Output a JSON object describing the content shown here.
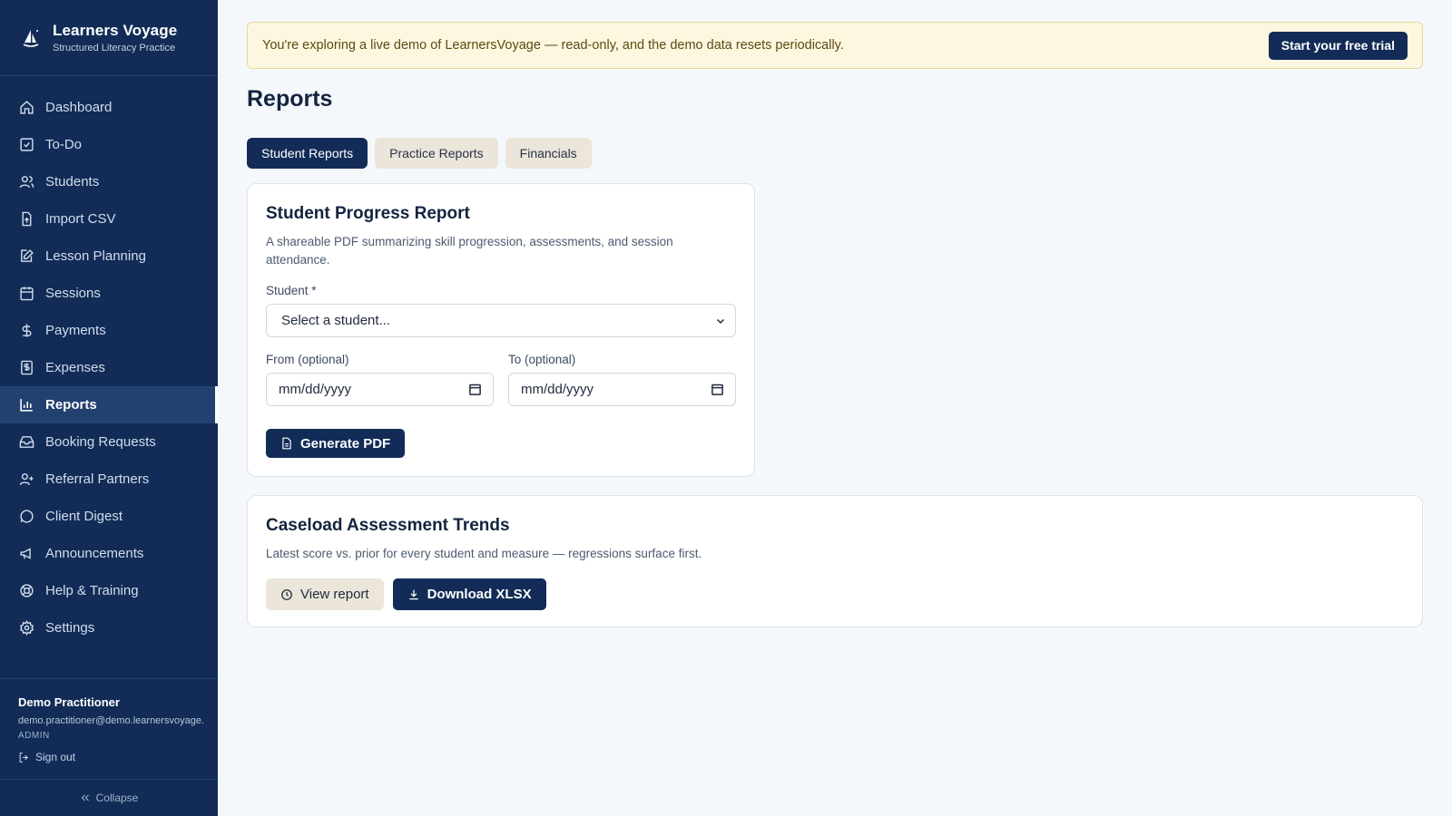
{
  "brand": {
    "title": "Learners Voyage",
    "subtitle": "Structured Literacy Practice"
  },
  "sidebar": {
    "items": [
      {
        "label": "Dashboard",
        "icon": "home-icon"
      },
      {
        "label": "To-Do",
        "icon": "checkbox-icon"
      },
      {
        "label": "Students",
        "icon": "users-icon"
      },
      {
        "label": "Import CSV",
        "icon": "file-upload-icon"
      },
      {
        "label": "Lesson Planning",
        "icon": "edit-icon"
      },
      {
        "label": "Sessions",
        "icon": "calendar-icon"
      },
      {
        "label": "Payments",
        "icon": "dollar-icon"
      },
      {
        "label": "Expenses",
        "icon": "receipt-icon"
      },
      {
        "label": "Reports",
        "icon": "bar-chart-icon",
        "active": true
      },
      {
        "label": "Booking Requests",
        "icon": "inbox-icon"
      },
      {
        "label": "Referral Partners",
        "icon": "user-plus-icon"
      },
      {
        "label": "Client Digest",
        "icon": "message-icon"
      },
      {
        "label": "Announcements",
        "icon": "megaphone-icon"
      },
      {
        "label": "Help & Training",
        "icon": "lifebuoy-icon"
      },
      {
        "label": "Settings",
        "icon": "gear-icon"
      }
    ]
  },
  "user": {
    "name": "Demo Practitioner",
    "email": "demo.practitioner@demo.learnersvoyage.",
    "role": "ADMIN",
    "signout": "Sign out"
  },
  "collapse_label": "Collapse",
  "banner": {
    "text": "You're exploring a live demo of LearnersVoyage — read-only, and the demo data resets periodically.",
    "cta": "Start your free trial"
  },
  "page_title": "Reports",
  "tabs": [
    {
      "label": "Student Reports",
      "active": true
    },
    {
      "label": "Practice Reports",
      "active": false
    },
    {
      "label": "Financials",
      "active": false
    }
  ],
  "progress_card": {
    "title": "Student Progress Report",
    "description": "A shareable PDF summarizing skill progression, assessments, and session attendance.",
    "student_label": "Student *",
    "student_placeholder": "Select a student...",
    "from_label": "From (optional)",
    "to_label": "To (optional)",
    "date_placeholder": "mm/dd/yyyy",
    "generate_label": "Generate PDF"
  },
  "trends_card": {
    "title": "Caseload Assessment Trends",
    "description": "Latest score vs. prior for every student and measure — regressions surface first.",
    "view_label": "View report",
    "download_label": "Download XLSX"
  },
  "colors": {
    "sidebar": "#122c57",
    "accent": "#122c57",
    "banner_bg": "#fdf7e0"
  }
}
